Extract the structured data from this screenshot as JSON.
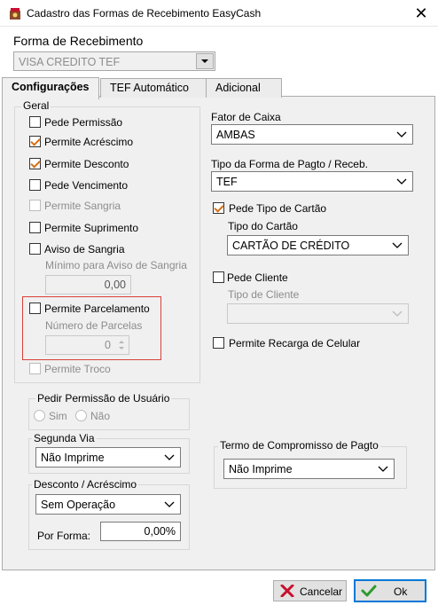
{
  "window": {
    "title": "Cadastro das Formas de Recebimento EasyCash"
  },
  "forma": {
    "label": "Forma de Recebimento",
    "value": "VISA CREDITO TEF"
  },
  "tabs": [
    {
      "label": "Configurações"
    },
    {
      "label": "TEF Automático"
    },
    {
      "label": "Adicional"
    }
  ],
  "geral": {
    "title": "Geral",
    "pede_permissao": "Pede Permissão",
    "permite_acrescimo": "Permite Acréscimo",
    "permite_desconto": "Permite Desconto",
    "pede_vencimento": "Pede Vencimento",
    "permite_sangria": "Permite Sangria",
    "permite_suprimento": "Permite Suprimento",
    "aviso_sangria": "Aviso de Sangria",
    "minimo_aviso_label": "Mínimo para Aviso de Sangria",
    "minimo_aviso_value": "0,00",
    "permite_parcelamento": "Permite Parcelamento",
    "numero_parcelas_label": "Número de Parcelas",
    "numero_parcelas_value": "0",
    "permite_troco": "Permite Troco"
  },
  "pedir_permissao": {
    "title": "Pedir Permissão de Usuário",
    "sim": "Sim",
    "nao": "Não"
  },
  "segunda_via": {
    "title": "Segunda Via",
    "value": "Não Imprime"
  },
  "desconto_acrescimo": {
    "title": "Desconto / Acréscimo",
    "value": "Sem Operação",
    "por_forma_label": "Por Forma:",
    "por_forma_value": "0,00%"
  },
  "fator_caixa": {
    "label": "Fator de Caixa",
    "value": "AMBAS"
  },
  "tipo_forma": {
    "label": "Tipo da Forma de Pagto / Receb.",
    "value": "TEF"
  },
  "pede_tipo_cartao": {
    "label": "Pede Tipo de Cartão"
  },
  "tipo_cartao": {
    "label": "Tipo do Cartão",
    "value": "CARTÃO DE CRÉDITO"
  },
  "pede_cliente": {
    "label": "Pede Cliente"
  },
  "tipo_cliente": {
    "label": "Tipo de Cliente",
    "value": ""
  },
  "recarga": {
    "label": "Permite Recarga de Celular"
  },
  "termo": {
    "title": "Termo de Compromisso de Pagto",
    "value": "Não Imprime"
  },
  "buttons": {
    "cancel": "Cancelar",
    "ok": "Ok"
  },
  "colors": {
    "accent": "#0078d7",
    "check": "#d66f16",
    "highlight": "#d9413a",
    "cancel_x": "#c8102e",
    "ok_check": "#2e9a2e"
  }
}
